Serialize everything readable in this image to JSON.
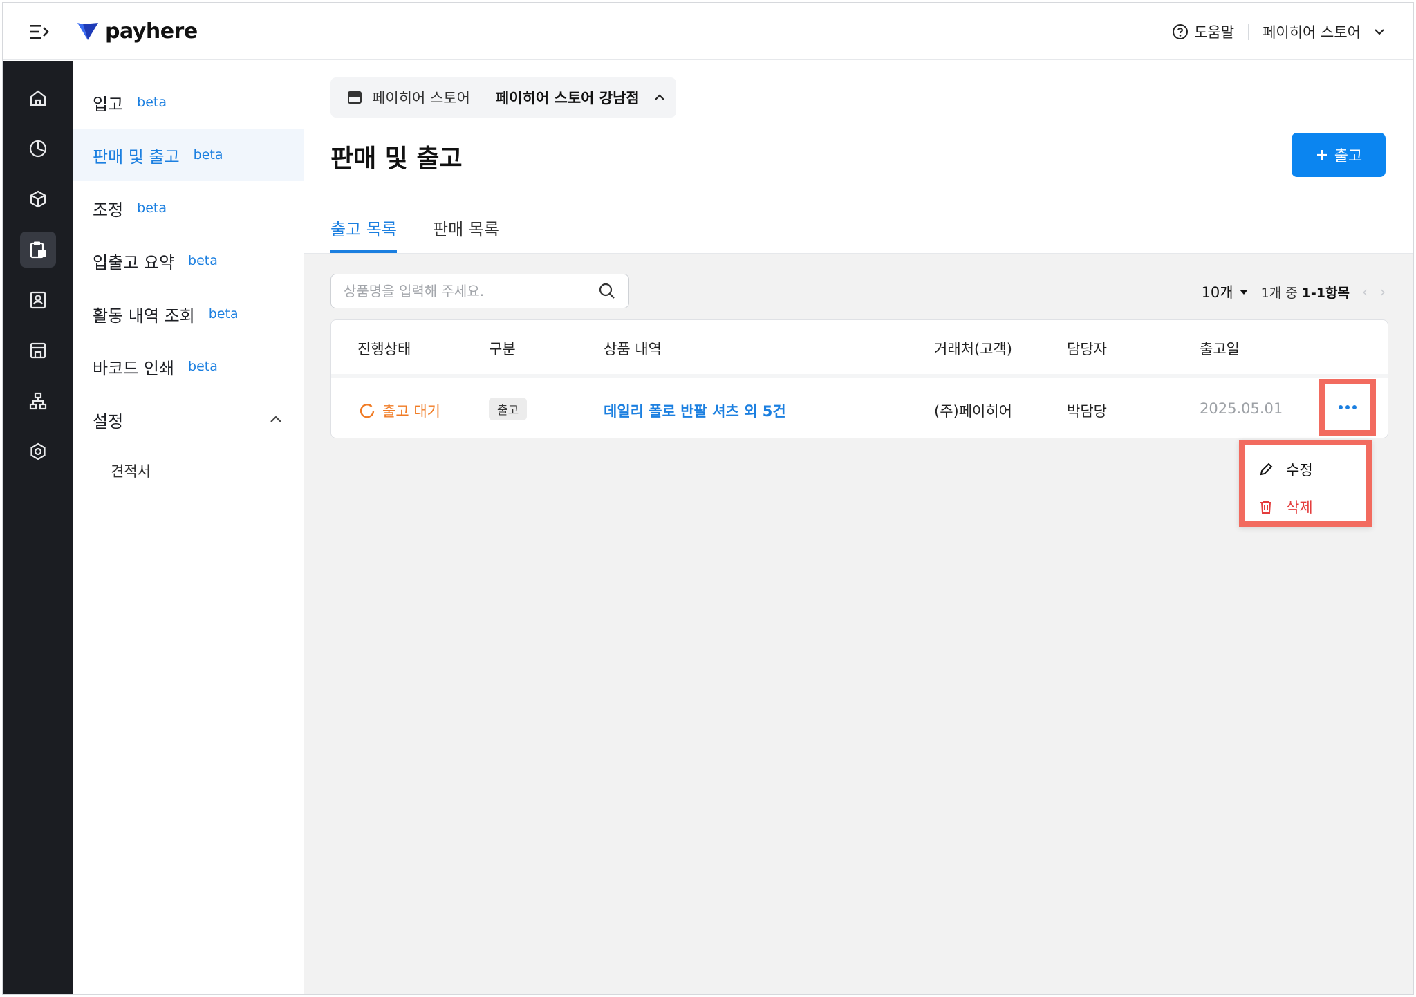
{
  "header": {
    "brand": "payhere",
    "help_label": "도움말",
    "store_name": "페이히어 스토어"
  },
  "sidebar": {
    "items": [
      {
        "label": "입고",
        "badge": "beta"
      },
      {
        "label": "판매 및 출고",
        "badge": "beta"
      },
      {
        "label": "조정",
        "badge": "beta"
      },
      {
        "label": "입출고 요약",
        "badge": "beta"
      },
      {
        "label": "활동 내역 조회",
        "badge": "beta"
      },
      {
        "label": "바코드 인쇄",
        "badge": "beta"
      }
    ],
    "settings": {
      "label": "설정",
      "children": [
        {
          "label": "견적서"
        }
      ]
    }
  },
  "main": {
    "store_pill": {
      "store": "페이히어 스토어",
      "branch": "페이히어 스토어 강남점"
    },
    "title": "판매 및 출고",
    "add_button": "출고",
    "tabs": [
      {
        "label": "출고 목록"
      },
      {
        "label": "판매 목록"
      }
    ],
    "search": {
      "placeholder": "상품명을 입력해 주세요."
    },
    "pager": {
      "page_size": "10개",
      "range_prefix": "1개 중",
      "range": "1-1항목"
    },
    "table": {
      "columns": [
        "진행상태",
        "구분",
        "상품 내역",
        "거래처(고객)",
        "담당자",
        "출고일"
      ],
      "rows": [
        {
          "status": "출고 대기",
          "type": "출고",
          "product": "데일리 폴로 반팔 셔츠 외 5건",
          "customer": "(주)페이히어",
          "manager": "박담당",
          "date": "2025.05.01"
        }
      ]
    },
    "menu": {
      "edit": "수정",
      "delete": "삭제"
    }
  },
  "colors": {
    "accent": "#1b7fe0",
    "primary_button": "#0b85f0",
    "status_pending": "#f07b24",
    "danger": "#e43d3d",
    "highlight": "#f26b5f",
    "rail": "#1b1d22"
  }
}
